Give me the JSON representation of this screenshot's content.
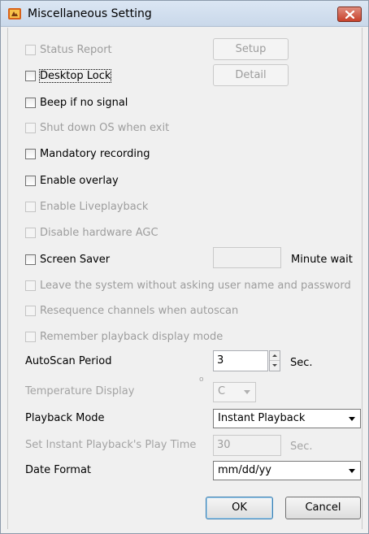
{
  "window": {
    "title": "Miscellaneous Setting"
  },
  "options": {
    "status_report": "Status Report",
    "desktop_lock": "Desktop Lock",
    "beep_no_signal": "Beep if no signal",
    "shutdown_os": "Shut down OS when exit",
    "mandatory_recording": "Mandatory recording",
    "enable_overlay": "Enable overlay",
    "enable_liveplayback": "Enable Liveplayback",
    "disable_agc": "Disable hardware AGC",
    "screen_saver": "Screen Saver",
    "leave_system": "Leave the system without asking user name and password",
    "resequence": "Resequence channels when autoscan",
    "remember_playback": "Remember playback display mode"
  },
  "buttons": {
    "setup": "Setup",
    "detail": "Detail",
    "ok": "OK",
    "cancel": "Cancel"
  },
  "screen_saver": {
    "value": "",
    "unit": "Minute wait"
  },
  "autoscan": {
    "label": "AutoScan Period",
    "value": "3",
    "unit": "Sec."
  },
  "temperature": {
    "label": "Temperature Display",
    "degree_symbol": "o",
    "value": "C"
  },
  "playback_mode": {
    "label": "Playback Mode",
    "value": "Instant Playback"
  },
  "instant_playtime": {
    "label": "Set Instant Playback's Play Time",
    "value": "30",
    "unit": "Sec."
  },
  "date_format": {
    "label": "Date Format",
    "value": "mm/dd/yy"
  },
  "icons": {
    "app": "settings-app-icon",
    "close": "close-icon",
    "dropdown": "chevron-down-icon",
    "spin_up": "spin-up-icon",
    "spin_down": "spin-down-icon"
  },
  "colors": {
    "title_bar": "#c9d8ea",
    "close_button": "#c8412b",
    "disabled_text": "#9d9d9d",
    "dialog_bg": "#f0f0f0"
  }
}
